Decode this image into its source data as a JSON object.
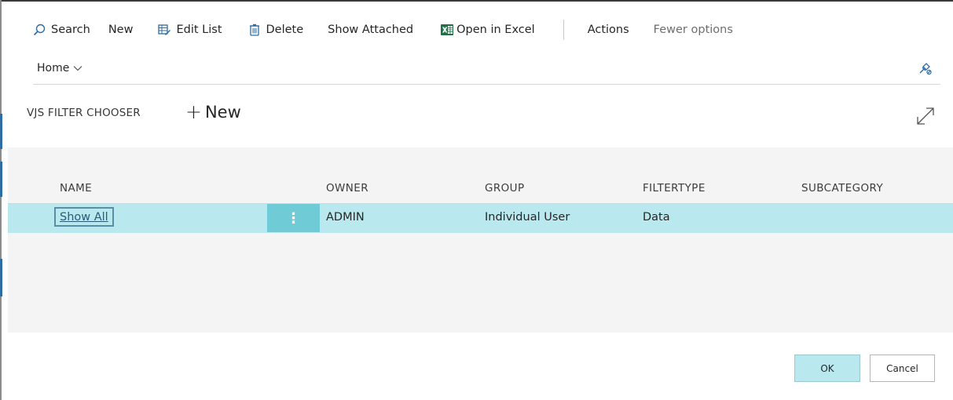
{
  "toolbar": {
    "search_label": "Search",
    "new_label": "New",
    "edit_list_label": "Edit List",
    "delete_label": "Delete",
    "show_attached_label": "Show Attached",
    "open_in_excel_label": "Open in Excel",
    "actions_label": "Actions",
    "fewer_options_label": "Fewer options"
  },
  "nav": {
    "home_label": "Home"
  },
  "section": {
    "title": "VJS FILTER CHOOSER",
    "new_label": "New"
  },
  "table": {
    "headers": [
      "NAME",
      "OWNER",
      "GROUP",
      "FILTERTYPE",
      "SUBCATEGORY"
    ],
    "rows": [
      {
        "name": "Show All",
        "owner": "ADMIN",
        "group": "Individual User",
        "filtertype": "Data",
        "subcategory": ""
      }
    ],
    "row_menu_glyph": "⋮"
  },
  "footer": {
    "ok_label": "OK",
    "cancel_label": "Cancel"
  },
  "icons": {
    "search": "search-icon",
    "edit_list": "edit-list-icon",
    "delete": "delete-icon",
    "excel": "excel-icon",
    "home_chevron": "chevron-down-icon",
    "pin": "pin-icon",
    "expand": "expand-icon"
  },
  "colors": {
    "accent": "#6fcbd6",
    "selection": "#b9e9ef",
    "excel_green": "#1e7145",
    "icon_blue": "#2e6da4"
  }
}
